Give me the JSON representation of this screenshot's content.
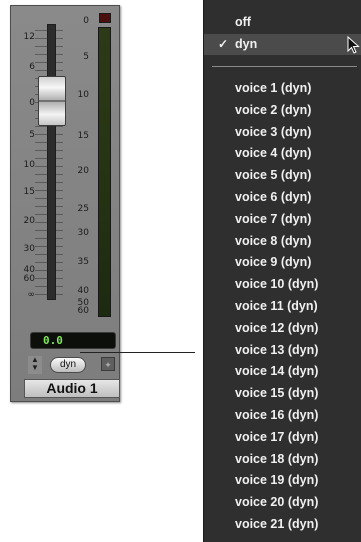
{
  "channel": {
    "fader_scale": [
      "12",
      "6",
      "0",
      "5",
      "10",
      "15",
      "20",
      "30",
      "40",
      "60",
      "∞"
    ],
    "meter_scale": [
      "0",
      "5",
      "10",
      "15",
      "20",
      "25",
      "30",
      "35",
      "40",
      "50",
      "60"
    ],
    "volume_display": "0.0",
    "automation_mode": "dyn",
    "track_name": "Audio 1"
  },
  "menu": {
    "items": [
      {
        "label": "off",
        "selected": false
      },
      {
        "label": "dyn",
        "selected": true
      },
      {
        "label": "voice 1 (dyn)",
        "selected": false
      },
      {
        "label": "voice 2 (dyn)",
        "selected": false
      },
      {
        "label": "voice 3 (dyn)",
        "selected": false
      },
      {
        "label": "voice 4 (dyn)",
        "selected": false
      },
      {
        "label": "voice 5 (dyn)",
        "selected": false
      },
      {
        "label": "voice 6 (dyn)",
        "selected": false
      },
      {
        "label": "voice 7 (dyn)",
        "selected": false
      },
      {
        "label": "voice 8 (dyn)",
        "selected": false
      },
      {
        "label": "voice 9 (dyn)",
        "selected": false
      },
      {
        "label": "voice 10 (dyn)",
        "selected": false
      },
      {
        "label": "voice 11 (dyn)",
        "selected": false
      },
      {
        "label": "voice 12 (dyn)",
        "selected": false
      },
      {
        "label": "voice 13 (dyn)",
        "selected": false
      },
      {
        "label": "voice 14 (dyn)",
        "selected": false
      },
      {
        "label": "voice 15 (dyn)",
        "selected": false
      },
      {
        "label": "voice 16 (dyn)",
        "selected": false
      },
      {
        "label": "voice 17 (dyn)",
        "selected": false
      },
      {
        "label": "voice 18 (dyn)",
        "selected": false
      },
      {
        "label": "voice 19 (dyn)",
        "selected": false
      },
      {
        "label": "voice 20 (dyn)",
        "selected": false
      },
      {
        "label": "voice 21 (dyn)",
        "selected": false
      }
    ],
    "check_mark": "✓"
  },
  "colors": {
    "strip_background": "#858585",
    "menu_background": "#2f2f2f",
    "menu_selected": "#4b4b4b",
    "volume_text": "#7ee65a"
  },
  "icons": {
    "cursor": "arrow-cursor-icon",
    "stepper": "up-down-stepper-icon",
    "mix": "mix-window-icon"
  }
}
